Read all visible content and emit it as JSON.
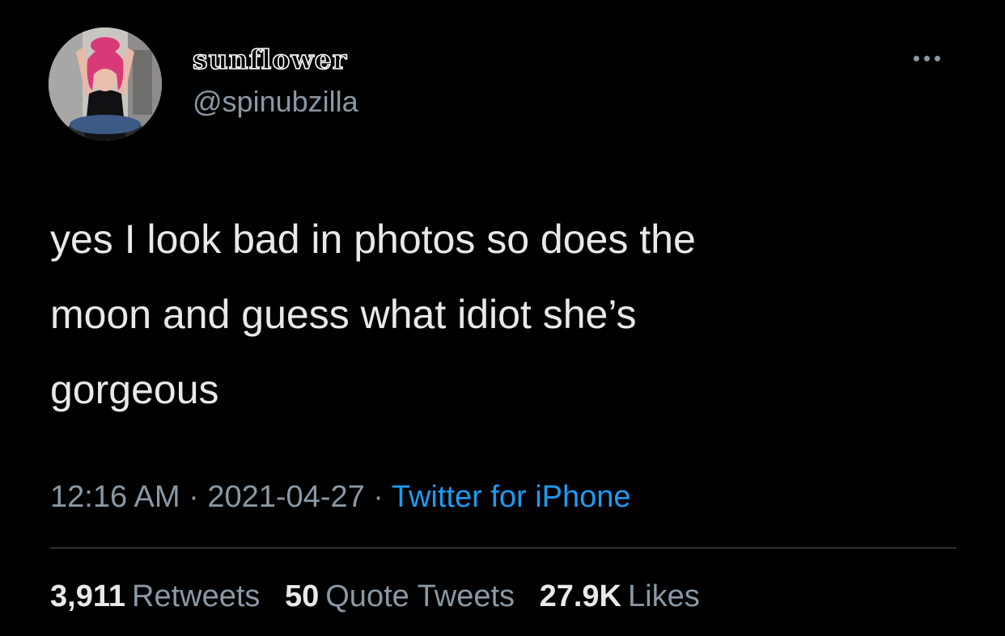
{
  "author": {
    "display_name": "sunflower",
    "handle": "@spinubzilla"
  },
  "tweet": {
    "lines": [
      "yes I look bad in photos so does the",
      "moon and guess what idiot she’s",
      "gorgeous"
    ],
    "time": "12:16 AM",
    "sep1": " · ",
    "date": "2021-04-27",
    "sep2": " · ",
    "source": "Twitter for iPhone"
  },
  "stats": {
    "retweets": {
      "count": "3,911",
      "label": "Retweets"
    },
    "quotes": {
      "count": "50",
      "label": "Quote Tweets"
    },
    "likes": {
      "count": "27.9K",
      "label": "Likes"
    }
  },
  "icons": {
    "more": "more-options-icon"
  },
  "colors": {
    "background": "#000000",
    "primary_text": "#e7e9ea",
    "secondary_text": "#8b98a5",
    "link": "#1d9bf0",
    "divider": "#2f3336"
  }
}
